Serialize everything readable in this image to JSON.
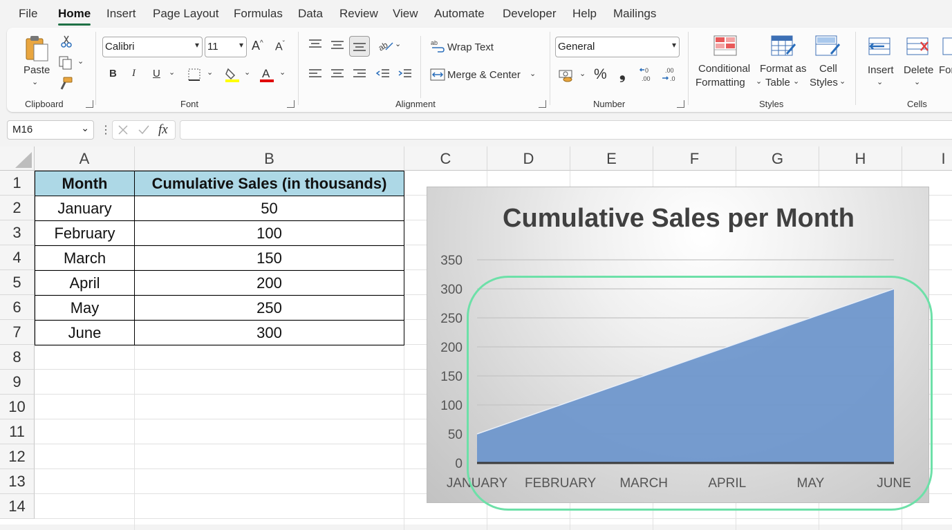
{
  "menu": {
    "tabs": [
      "File",
      "Home",
      "Insert",
      "Page Layout",
      "Formulas",
      "Data",
      "Review",
      "View",
      "Automate",
      "Developer",
      "Help",
      "Mailings"
    ],
    "active": "Home"
  },
  "ribbon": {
    "clipboard": {
      "paste_label": "Paste",
      "group_label": "Clipboard"
    },
    "font": {
      "font_name": "Calibri",
      "font_size": "11",
      "bold": "B",
      "italic": "I",
      "underline": "U",
      "group_label": "Font"
    },
    "alignment": {
      "wrap_text": "Wrap Text",
      "merge_center": "Merge & Center",
      "group_label": "Alignment"
    },
    "number": {
      "format": "General",
      "percent": "%",
      "comma": "❟",
      "group_label": "Number"
    },
    "styles": {
      "conditional_1": "Conditional",
      "conditional_2": "Formatting",
      "format_table_1": "Format as",
      "format_table_2": "Table",
      "cell_styles_1": "Cell",
      "cell_styles_2": "Styles",
      "group_label": "Styles"
    },
    "cells": {
      "insert": "Insert",
      "delete": "Delete",
      "format": "For",
      "group_label": "Cells"
    }
  },
  "formula_bar": {
    "name_box": "M16",
    "fx": "fx",
    "content": ""
  },
  "columns": [
    "A",
    "B",
    "C",
    "D",
    "E",
    "F",
    "G",
    "H",
    "I"
  ],
  "rows": [
    "1",
    "2",
    "3",
    "4",
    "5",
    "6",
    "7",
    "8",
    "9",
    "10",
    "11",
    "12",
    "13",
    "14"
  ],
  "table": {
    "headers": [
      "Month",
      "Cumulative Sales (in thousands)"
    ],
    "rows": [
      [
        "January",
        "50"
      ],
      [
        "February",
        "100"
      ],
      [
        "March",
        "150"
      ],
      [
        "April",
        "200"
      ],
      [
        "May",
        "250"
      ],
      [
        "June",
        "300"
      ]
    ]
  },
  "colors": {
    "area_fill": "#6f97cc",
    "header_fill": "#add8e6",
    "highlight": "#6de0a8",
    "excel_green": "#1e7145"
  },
  "chart_data": {
    "type": "area",
    "title": "Cumulative Sales per Month",
    "categories": [
      "JANUARY",
      "FEBRUARY",
      "MARCH",
      "APRIL",
      "MAY",
      "JUNE"
    ],
    "series": [
      {
        "values": [
          50,
          100,
          150,
          200,
          250,
          300
        ]
      }
    ],
    "yticks": [
      0,
      50,
      100,
      150,
      200,
      250,
      300,
      350
    ],
    "ylim": [
      0,
      350
    ],
    "grid": true,
    "legend": "none"
  }
}
